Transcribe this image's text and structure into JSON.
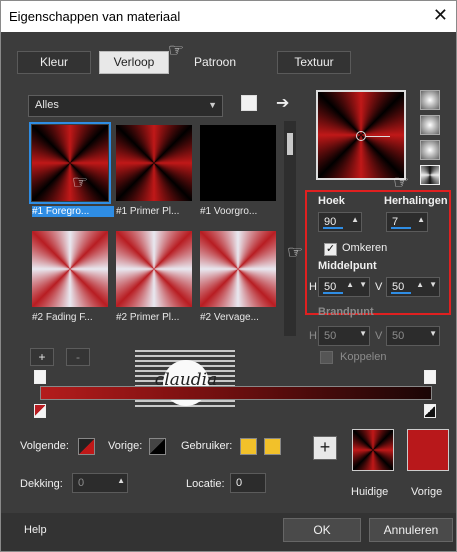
{
  "window": {
    "title": "Eigenschappen van materiaal",
    "close_glyph": "✕"
  },
  "tabs": [
    {
      "label": "Kleur",
      "active": false
    },
    {
      "label": "Verloop",
      "active": true
    },
    {
      "label": "Patroon",
      "active": false
    },
    {
      "label": "Textuur",
      "active": false
    }
  ],
  "gallery": {
    "filter_value": "Alles",
    "items": [
      {
        "label": "#1 Foregro...",
        "style": "red-radial",
        "selected": true
      },
      {
        "label": "#1 Primer Pl...",
        "style": "red-radial",
        "selected": false
      },
      {
        "label": "#1 Voorgro...",
        "style": "black",
        "selected": false
      },
      {
        "label": "#2 Fading F...",
        "style": "fading",
        "selected": false
      },
      {
        "label": "#2 Primer Pl...",
        "style": "fading",
        "selected": false
      },
      {
        "label": "#2 Vervage...",
        "style": "fading",
        "selected": false
      }
    ],
    "add_label": "+",
    "remove_label": "-"
  },
  "settings": {
    "hoek_label": "Hoek",
    "hoek_value": "90",
    "herhalingen_label": "Herhalingen",
    "herhalingen_value": "7",
    "omkeren_label": "Omkeren",
    "omkeren_checked": true,
    "middelpunt_label": "Middelpunt",
    "h_label": "H",
    "h_value": "50",
    "v_label": "V",
    "v_value": "50",
    "brandpunt_label": "Brandpunt",
    "brand_h_value": "50",
    "brand_v_value": "50",
    "koppelen_label": "Koppelen",
    "koppelen_checked": false
  },
  "watermark": {
    "text": "claudia"
  },
  "editor": {
    "volgende_label": "Volgende:",
    "vorige_label": "Vorige:",
    "gebruiker_label": "Gebruiker:",
    "user_color_1": "#f2c12a",
    "user_color_2": "#f2c12a",
    "dekking_label": "Dekking:",
    "dekking_value": "0",
    "locatie_label": "Locatie:",
    "locatie_value": "0",
    "add_button": "+",
    "huidige_label": "Huidige",
    "vorige_swatch_label": "Vorige",
    "current_color": "#b8181b"
  },
  "footer": {
    "help": "Help",
    "ok": "OK",
    "cancel": "Annuleren"
  }
}
